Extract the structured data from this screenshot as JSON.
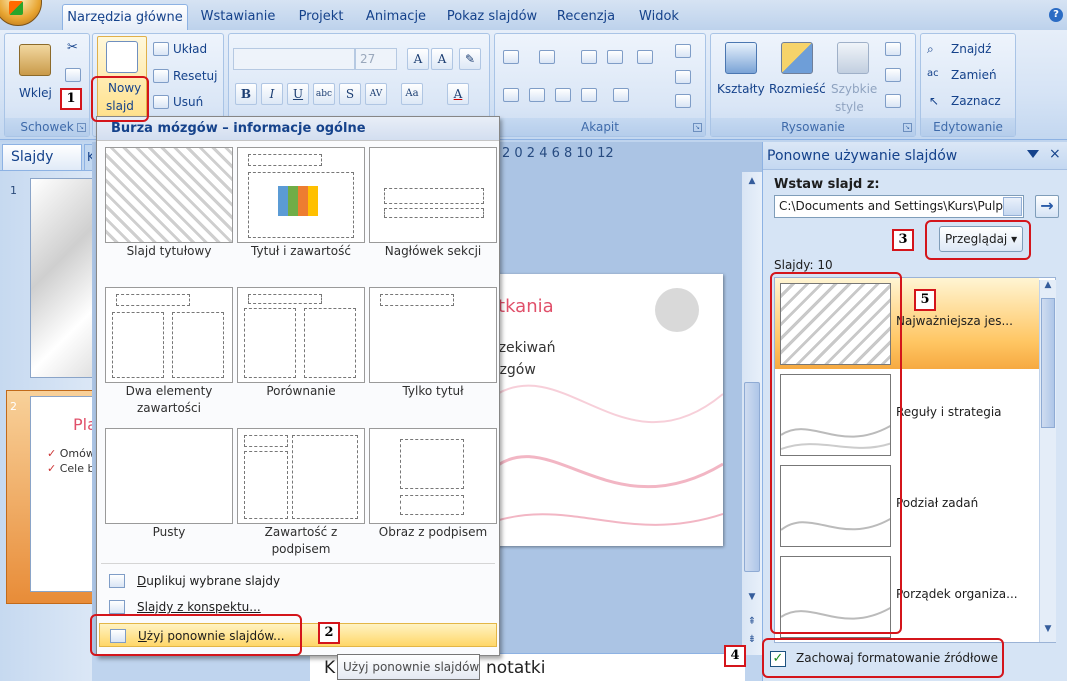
{
  "tabs": [
    {
      "label": "Narzędzia główne",
      "active": true
    },
    {
      "label": "Wstawianie"
    },
    {
      "label": "Projekt"
    },
    {
      "label": "Animacje"
    },
    {
      "label": "Pokaz slajdów"
    },
    {
      "label": "Recenzja"
    },
    {
      "label": "Widok"
    }
  ],
  "help": "?",
  "ribbon": {
    "clipboard": {
      "paste": "Wklej",
      "group": "Schowek"
    },
    "slides": {
      "new_slide_line1": "Nowy",
      "new_slide_line2": "slajd",
      "layout": "Układ",
      "reset": "Resetuj",
      "delete": "Usuń"
    },
    "font": {
      "size": "27"
    },
    "paragraph": {
      "group": "Akapit"
    },
    "drawing": {
      "shapes": "Kształty",
      "arrange": "Rozmieść",
      "quick_styles_1": "Szybkie",
      "quick_styles_2": "style",
      "group": "Rysowanie"
    },
    "editing": {
      "find": "Znajdź",
      "replace": "Zamień",
      "select": "Zaznacz",
      "group": "Edytowanie"
    }
  },
  "left_panel": {
    "tab": "Slajdy",
    "tab2": "K",
    "slide_nums": [
      "1",
      "2"
    ],
    "thumb2_title": "Pla",
    "thumb2_b1": "Omów",
    "thumb2_b2": "Cele b"
  },
  "ruler": "2  0  2  4  6  8  10  12",
  "slide": {
    "title_partial": "otkania",
    "line1": "czekiwań",
    "line2": "ózgów"
  },
  "notes": {
    "text": "notatki",
    "prefix": "K"
  },
  "dropdown": {
    "header": "Burza mózgów – informacje ogólne",
    "layouts": [
      {
        "label": "Slajd tytułowy"
      },
      {
        "label": "Tytuł i zawartość"
      },
      {
        "label": "Nagłówek sekcji"
      },
      {
        "label": "Dwa elementy zawartości"
      },
      {
        "label": "Porównanie"
      },
      {
        "label": "Tylko tytuł"
      },
      {
        "label": "Pusty"
      },
      {
        "label": "Zawartość z podpisem"
      },
      {
        "label": "Obraz z podpisem"
      }
    ],
    "duplicate_u": "D",
    "duplicate_rest": "uplikuj wybrane slajdy",
    "outline": "Slajdy z konspektu...",
    "reuse_u": "U",
    "reuse_rest": "żyj ponownie slajdów..."
  },
  "tooltip": "Użyj ponownie slajdów",
  "task_pane": {
    "title": "Ponowne używanie slajdów",
    "close": "×",
    "insert_from": "Wstaw slajd z:",
    "path": "C:\\Documents and Settings\\Kurs\\Pulpi",
    "go": "→",
    "browse": "Przeglądaj",
    "count": "Slajdy: 10",
    "slides": [
      {
        "title": "Najważniejsza jes...",
        "selected": true
      },
      {
        "title": "Reguły i strategia"
      },
      {
        "title": "Podział zadań"
      },
      {
        "title": "Porządek organiza..."
      }
    ],
    "keep_formatting": "Zachowaj formatowanie źródłowe"
  },
  "markers": [
    "1",
    "2",
    "3",
    "4",
    "5"
  ],
  "colors": {
    "accent": "#15428b",
    "marker": "#d4151b",
    "highlight": "#ffd769",
    "slide_title": "#e0506a"
  }
}
